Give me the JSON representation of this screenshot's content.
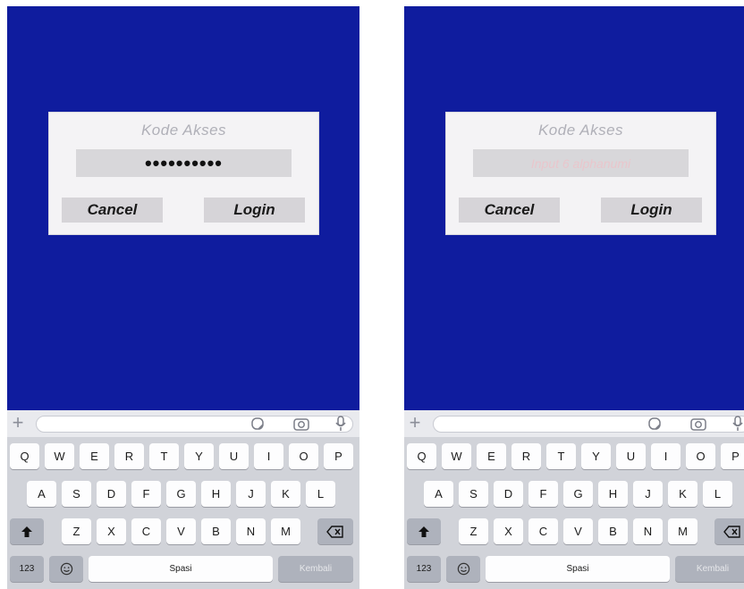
{
  "panels": [
    {
      "dialog": {
        "title": "Kode Akses",
        "input_value": "••••••••••",
        "placeholder": "",
        "cancel_label": "Cancel",
        "login_label": "Login"
      },
      "keyboard": {
        "row1": [
          "Q",
          "W",
          "E",
          "R",
          "T",
          "Y",
          "U",
          "I",
          "O",
          "P"
        ],
        "row2": [
          "A",
          "S",
          "D",
          "F",
          "G",
          "H",
          "J",
          "K",
          "L"
        ],
        "row3": [
          "Z",
          "X",
          "C",
          "V",
          "B",
          "N",
          "M"
        ],
        "numbers_label": "123",
        "space_label": "Spasi",
        "return_label": "Kembali"
      }
    },
    {
      "dialog": {
        "title": "Kode Akses",
        "input_value": "",
        "placeholder": "Input 6 alphanumi",
        "cancel_label": "Cancel",
        "login_label": "Login"
      },
      "keyboard": {
        "row1": [
          "Q",
          "W",
          "E",
          "R",
          "T",
          "Y",
          "U",
          "I",
          "O",
          "P"
        ],
        "row2": [
          "A",
          "S",
          "D",
          "F",
          "G",
          "H",
          "J",
          "K",
          "L"
        ],
        "row3": [
          "Z",
          "X",
          "C",
          "V",
          "B",
          "N",
          "M"
        ],
        "numbers_label": "123",
        "space_label": "Spasi",
        "return_label": "Kembali"
      }
    }
  ],
  "colors": {
    "screen": "#0f1c9e",
    "dialog": "#f4f3f5",
    "keyboard": "#d1d3d9"
  },
  "icons": [
    "plus-icon",
    "sticker-icon",
    "camera-icon",
    "microphone-icon",
    "shift-icon",
    "delete-icon",
    "emoji-icon"
  ]
}
